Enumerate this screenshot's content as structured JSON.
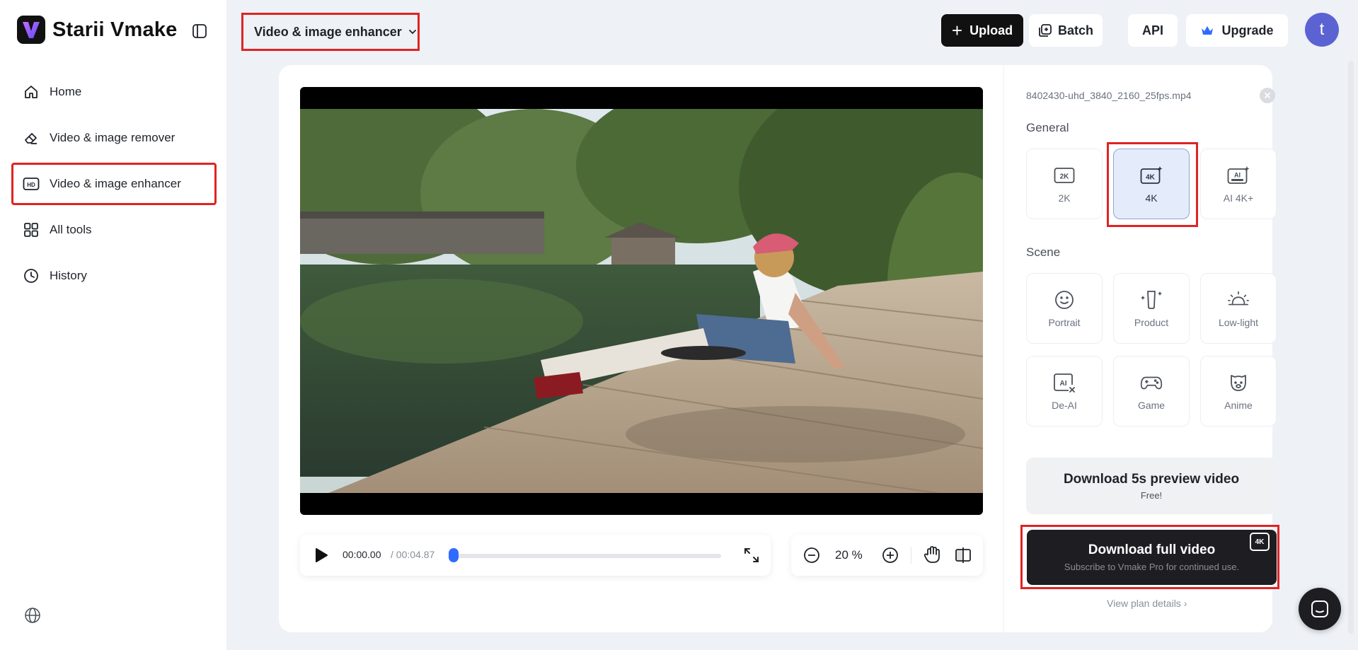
{
  "brand": {
    "name": "Starii Vmake",
    "logo_letter": "V"
  },
  "sidebar": {
    "items": [
      {
        "label": "Home",
        "icon": "home-icon"
      },
      {
        "label": "Video & image remover",
        "icon": "eraser-icon"
      },
      {
        "label": "Video & image enhancer",
        "icon": "hd-icon",
        "active": true
      },
      {
        "label": "All tools",
        "icon": "grid-icon"
      },
      {
        "label": "History",
        "icon": "clock-icon"
      }
    ]
  },
  "topbar": {
    "tool_select": "Video & image enhancer",
    "upload_label": "Upload",
    "batch_label": "Batch",
    "api_label": "API",
    "upgrade_label": "Upgrade",
    "avatar_letter": "t"
  },
  "player": {
    "current_time": "00:00.00",
    "total_time": "/ 00:04.87",
    "progress": 0.0
  },
  "zoom": {
    "value": "20 %"
  },
  "panel": {
    "file_name": "8402430-uhd_3840_2160_25fps.mp4",
    "general_label": "General",
    "general_options": [
      {
        "label": "2K",
        "icon": "2k-icon"
      },
      {
        "label": "4K",
        "icon": "4k-icon",
        "selected": true
      },
      {
        "label": "AI 4K+",
        "icon": "ai-4k-icon"
      }
    ],
    "scene_label": "Scene",
    "scene_options": [
      {
        "label": "Portrait",
        "icon": "smile-icon"
      },
      {
        "label": "Product",
        "icon": "product-icon"
      },
      {
        "label": "Low-light",
        "icon": "low-light-icon"
      },
      {
        "label": "De-AI",
        "icon": "de-ai-icon"
      },
      {
        "label": "Game",
        "icon": "gamepad-icon"
      },
      {
        "label": "Anime",
        "icon": "anime-icon"
      }
    ],
    "preview_button": {
      "title": "Download 5s preview video",
      "subtitle": "Free!"
    },
    "full_button": {
      "title": "Download full video",
      "subtitle": "Subscribe to Vmake Pro for continued use.",
      "badge": "4K"
    },
    "plan_link": "View plan details ›"
  },
  "colors": {
    "accent_blue": "#2f6bff",
    "highlight_red": "#e02323",
    "dark_button": "#1e1e22",
    "avatar": "#5b63d3"
  }
}
